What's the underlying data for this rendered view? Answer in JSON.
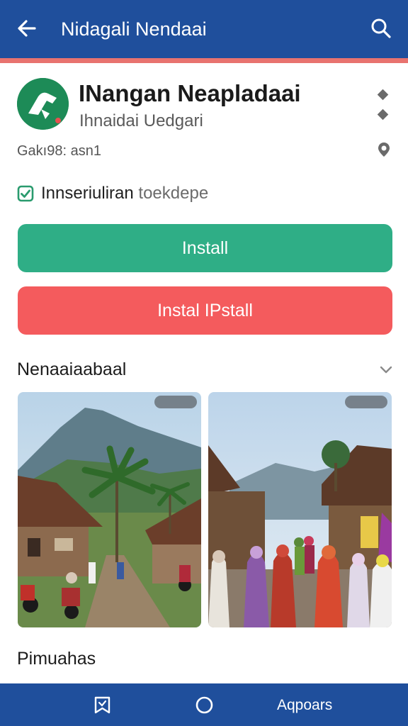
{
  "header": {
    "title": "Nidagali Nendaai",
    "back_icon": "arrow-left-icon",
    "search_icon": "search-icon",
    "bar_color": "#1f4f9c",
    "accent_color": "#e8736f"
  },
  "app": {
    "name": "INangan Neapladaai",
    "developer": "Ihnaidai Uedgari",
    "meta": "Gakı98: asn1",
    "verified_label": "Innseriuliran",
    "verified_suffix": "toekdepe",
    "logo_color": "#1d8b57"
  },
  "actions": {
    "install_label": "Install",
    "install_color": "#2fae86",
    "uninstall_label": "Instal IPstall",
    "uninstall_color": "#f45b5d"
  },
  "sections": {
    "screenshots_title": "Nenaaiaabaal",
    "second_title": "Pimuahas"
  },
  "screenshots": [
    {
      "scene": "volcano-village-street"
    },
    {
      "scene": "market-crowd"
    }
  ],
  "bottom_nav": {
    "items": [
      {
        "icon": "bookmark-book-icon"
      },
      {
        "icon": "home-circle-icon"
      },
      {
        "label": "Aqpoars"
      }
    ]
  }
}
